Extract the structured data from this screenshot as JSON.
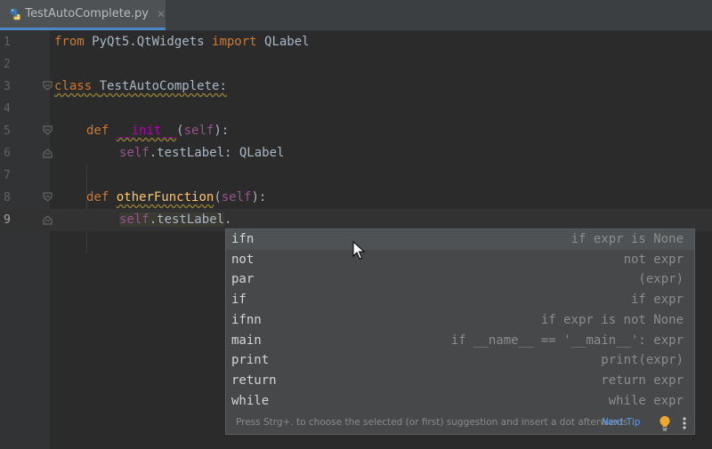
{
  "tab": {
    "filename": "TestAutoComplete.py",
    "close_glyph": "✕"
  },
  "lines": [
    {
      "num": "1"
    },
    {
      "num": "2"
    },
    {
      "num": "3"
    },
    {
      "num": "4"
    },
    {
      "num": "5"
    },
    {
      "num": "6"
    },
    {
      "num": "7"
    },
    {
      "num": "8"
    },
    {
      "num": "9"
    }
  ],
  "code": {
    "l1": {
      "from": "from",
      "module": " PyQt5.QtWidgets ",
      "import": "import",
      "name": " QLabel"
    },
    "l3": {
      "class": "class",
      "space": " ",
      "name": "TestAutoComplete:"
    },
    "l5": {
      "def": "def",
      "space": " ",
      "name": "__init__",
      "open": "(",
      "self": "self",
      "close": "):"
    },
    "l6": {
      "self": "self",
      "rest": ".testLabel: QLabel"
    },
    "l8": {
      "def": "def",
      "space": " ",
      "name": "otherFunction",
      "open": "(",
      "self": "self",
      "close": "):"
    },
    "l9": {
      "self": "self",
      "hl": ".testLabel",
      "dot": "."
    }
  },
  "completion": {
    "items": [
      {
        "name": "ifn",
        "desc": "if expr is None"
      },
      {
        "name": "not",
        "desc": "not expr"
      },
      {
        "name": "par",
        "desc": "(expr)"
      },
      {
        "name": "if",
        "desc": "if expr"
      },
      {
        "name": "ifnn",
        "desc": "if expr is not None"
      },
      {
        "name": "main",
        "desc": "if __name__ == '__main__': expr"
      },
      {
        "name": "print",
        "desc": "print(expr)"
      },
      {
        "name": "return",
        "desc": "return expr"
      },
      {
        "name": "while",
        "desc": "while expr"
      }
    ],
    "hint": "Press Strg+. to choose the selected (or first) suggestion and insert a dot afterwards",
    "next_tip": "Next Tip"
  },
  "colors": {
    "keyword": "#cc7832",
    "function": "#ffc66d",
    "magic": "#b200b2",
    "self": "#94558d",
    "link": "#589df6",
    "bulb": "#f0a732"
  }
}
